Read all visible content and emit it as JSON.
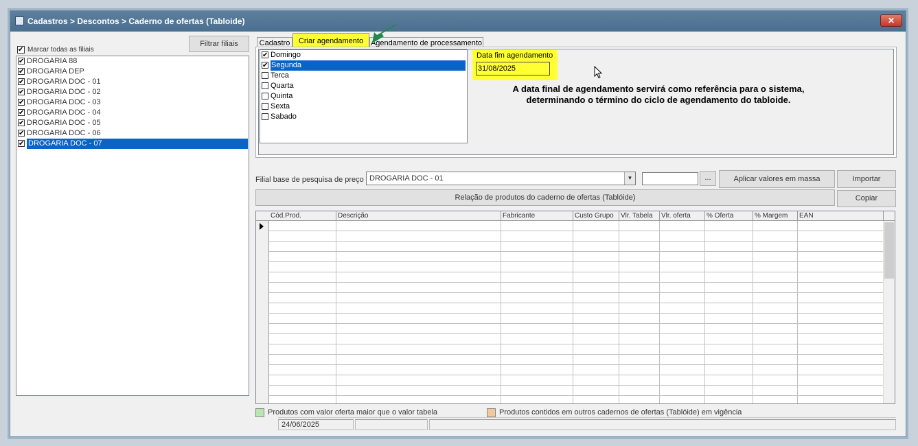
{
  "window": {
    "title": "Cadastros > Descontos > Caderno de ofertas (Tabloide)",
    "close_label": "✕"
  },
  "left_panel": {
    "filter_button": "Filtrar filiais",
    "check_all_label": "Marcar todas as filiais",
    "branches": [
      {
        "label": "DROGARIA 88",
        "checked": true,
        "selected": false
      },
      {
        "label": "DROGARIA DEP",
        "checked": true,
        "selected": false
      },
      {
        "label": "DROGARIA DOC - 01",
        "checked": true,
        "selected": false
      },
      {
        "label": "DROGARIA DOC - 02",
        "checked": true,
        "selected": false
      },
      {
        "label": "DROGARIA DOC - 03",
        "checked": true,
        "selected": false
      },
      {
        "label": "DROGARIA DOC - 04",
        "checked": true,
        "selected": false
      },
      {
        "label": "DROGARIA DOC - 05",
        "checked": true,
        "selected": false
      },
      {
        "label": "DROGARIA DOC - 06",
        "checked": true,
        "selected": false
      },
      {
        "label": "DROGARIA DOC - 07",
        "checked": true,
        "selected": true
      }
    ]
  },
  "tabs": {
    "items": [
      "Cadastro",
      "Criar agendamento",
      "Agendamento de processamento"
    ],
    "active": "Criar agendamento"
  },
  "schedule": {
    "days": [
      {
        "label": "Domingo",
        "checked": true,
        "selected": false
      },
      {
        "label": "Segunda",
        "checked": true,
        "selected": true
      },
      {
        "label": "Terca",
        "checked": false,
        "selected": false
      },
      {
        "label": "Quarta",
        "checked": false,
        "selected": false
      },
      {
        "label": "Quinta",
        "checked": false,
        "selected": false
      },
      {
        "label": "Sexta",
        "checked": false,
        "selected": false
      },
      {
        "label": "Sabado",
        "checked": false,
        "selected": false
      }
    ],
    "end_date_label": "Data fim agendamento",
    "end_date_value": "31/08/2025",
    "note_line1": "A data final de agendamento servirá como referência para o sistema,",
    "note_line2": "determinando o término do ciclo de agendamento do tabloide."
  },
  "products": {
    "base_branch_label": "Filial base de pesquisa de preço",
    "base_branch_value": "DROGARIA DOC - 01",
    "dots_label": "...",
    "mass_apply_button": "Aplicar valores em massa",
    "import_button": "Importar",
    "copy_button": "Copiar",
    "list_title": "Relação de produtos do caderno de ofertas (Tablóide)",
    "columns": [
      "Cód.Prod.",
      "Descrição",
      "Fabricante",
      "Custo Grupo",
      "Vlr. Tabela",
      "Vlr. oferta",
      "% Oferta",
      "% Margem",
      "EAN"
    ]
  },
  "legend": {
    "green_label": "Produtos com valor oferta maior que o valor tabela",
    "green_color": "#b6e8b0",
    "orange_label": "Produtos contidos em outros cadernos de ofertas (Tablóide) em vigência",
    "orange_color": "#f3c99a"
  },
  "status": {
    "date": "24/06/2025"
  },
  "colors": {
    "highlight": "#ffff33",
    "selection": "#0a64c8",
    "annotation_arrow": "#1f8a4c"
  }
}
